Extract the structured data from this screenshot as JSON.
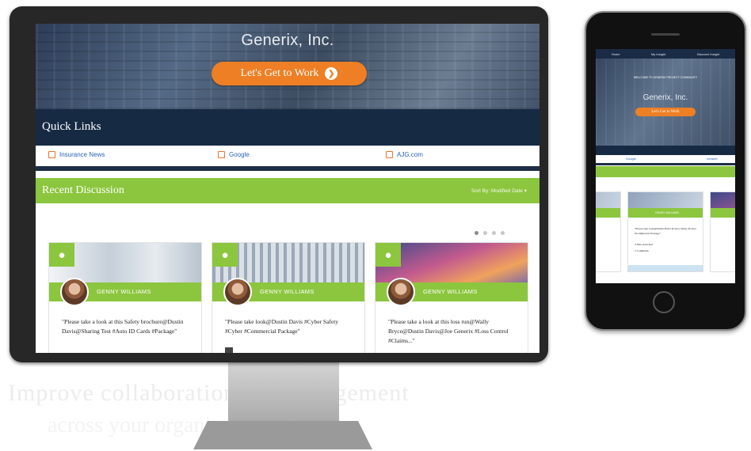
{
  "monitor": {
    "brand_title": "Generix, Inc.",
    "cta_label": "Let's Get to Work",
    "quick_links": {
      "title": "Quick Links",
      "items": [
        {
          "label": "Insurance News"
        },
        {
          "label": "Google"
        },
        {
          "label": "AJG.com"
        }
      ]
    },
    "recent_discussion": {
      "title": "Recent Discussion",
      "sort_label": "Sort By: Modified Date",
      "cards": [
        {
          "author": "GENNY WILLIAMS",
          "text": "\"Please take a look at this Safety brochure@Dustin Davis@Sharing Test #Auto ID Cards #Package\""
        },
        {
          "author": "GENNY WILLIAMS",
          "text": "\"Please take look@Dustin Davis #Cyber Safety #Cyber #Commercial Package\""
        },
        {
          "author": "GENNY WILLIAMS",
          "text": "\"Please take a look at this loss run@Wally Bryce@Dustin Davis@Joe Generix #Loss Control #Claims...\""
        }
      ]
    }
  },
  "phone": {
    "nav": [
      "Home",
      "My Insight",
      "Discover Insight"
    ],
    "welcome": "WELCOME TO GENERIX PROJECT COMMUNITY",
    "brand_title": "Generix, Inc.",
    "cta_label": "Let's Get to Work",
    "links": [
      "Google",
      "Intranet"
    ],
    "card": {
      "author": "GENNY WILLIAMS",
      "text": "\"Please take look@Dustin Davis #Cyber Safety #Cyber #Commercial Package\"",
      "meta": [
        "3 Files Attached",
        "2 Comments"
      ]
    }
  },
  "colors": {
    "accent_green": "#8cc63e",
    "cta_orange": "#ee7f24",
    "navy": "#162a44"
  }
}
